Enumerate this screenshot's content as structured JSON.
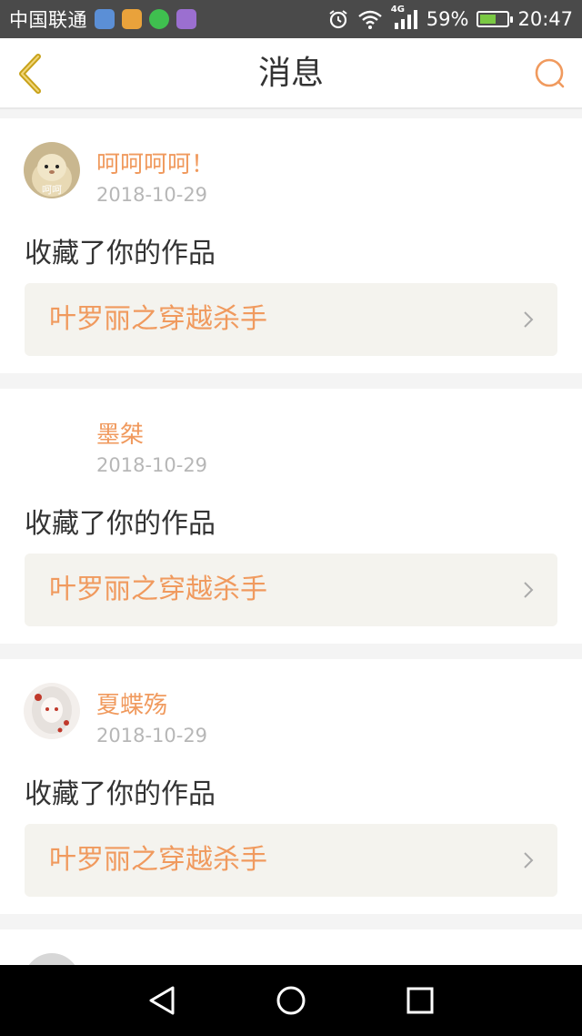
{
  "status_bar": {
    "carrier": "中国联通",
    "network": "4G",
    "battery": "59%",
    "battery_level": 0.59,
    "time": "20:47"
  },
  "header": {
    "title": "消息"
  },
  "messages": [
    {
      "username": "呵呵呵呵！",
      "avatar_text": "呵呵",
      "date": "2018-10-29",
      "action": "收藏了你的作品",
      "work_title": "叶罗丽之穿越杀手"
    },
    {
      "username": "墨桀",
      "date": "2018-10-29",
      "action": "收藏了你的作品",
      "work_title": "叶罗丽之穿越杀手"
    },
    {
      "username": "夏蝶殇",
      "date": "2018-10-29",
      "action": "收藏了你的作品",
      "work_title": "叶罗丽之穿越杀手"
    }
  ],
  "colors": {
    "accent": "#f09a5e",
    "back_icon": "#c8a21a",
    "status_bar_bg": "#4a4a4a"
  },
  "icons": [
    "back-arrow-icon",
    "search-icon",
    "chevron-right-icon",
    "alarm-icon",
    "wifi-icon",
    "signal-icon",
    "battery-icon",
    "nav-back-icon",
    "nav-home-icon",
    "nav-recents-icon"
  ]
}
